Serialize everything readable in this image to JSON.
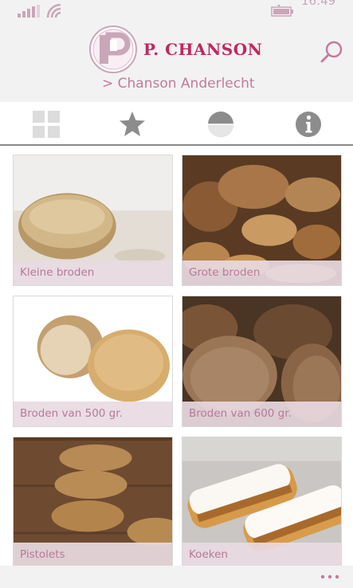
{
  "status": {
    "time": "16:49",
    "icons": [
      "signal-icon",
      "wifi-icon",
      "battery-icon"
    ]
  },
  "header": {
    "logo_letter": "P",
    "brand": "P. CHANSON",
    "breadcrumb": "> Chanson Anderlecht",
    "search_icon": "search-icon"
  },
  "tabs": [
    {
      "icon": "grid-icon"
    },
    {
      "icon": "star-icon"
    },
    {
      "icon": "half-circle-icon"
    },
    {
      "icon": "info-icon"
    }
  ],
  "categories": [
    {
      "label": "Kleine broden"
    },
    {
      "label": "Grote broden"
    },
    {
      "label": "Broden van 500 gr."
    },
    {
      "label": "Broden van 600 gr."
    },
    {
      "label": "Pistolets"
    },
    {
      "label": "Koeken"
    }
  ],
  "appbar": {
    "more_icon": "more-icon"
  },
  "colors": {
    "brand": "#c0285e",
    "accent": "#c47a9a",
    "caption_bg": "#e8dae2",
    "header_bg": "#f2f2f2"
  }
}
